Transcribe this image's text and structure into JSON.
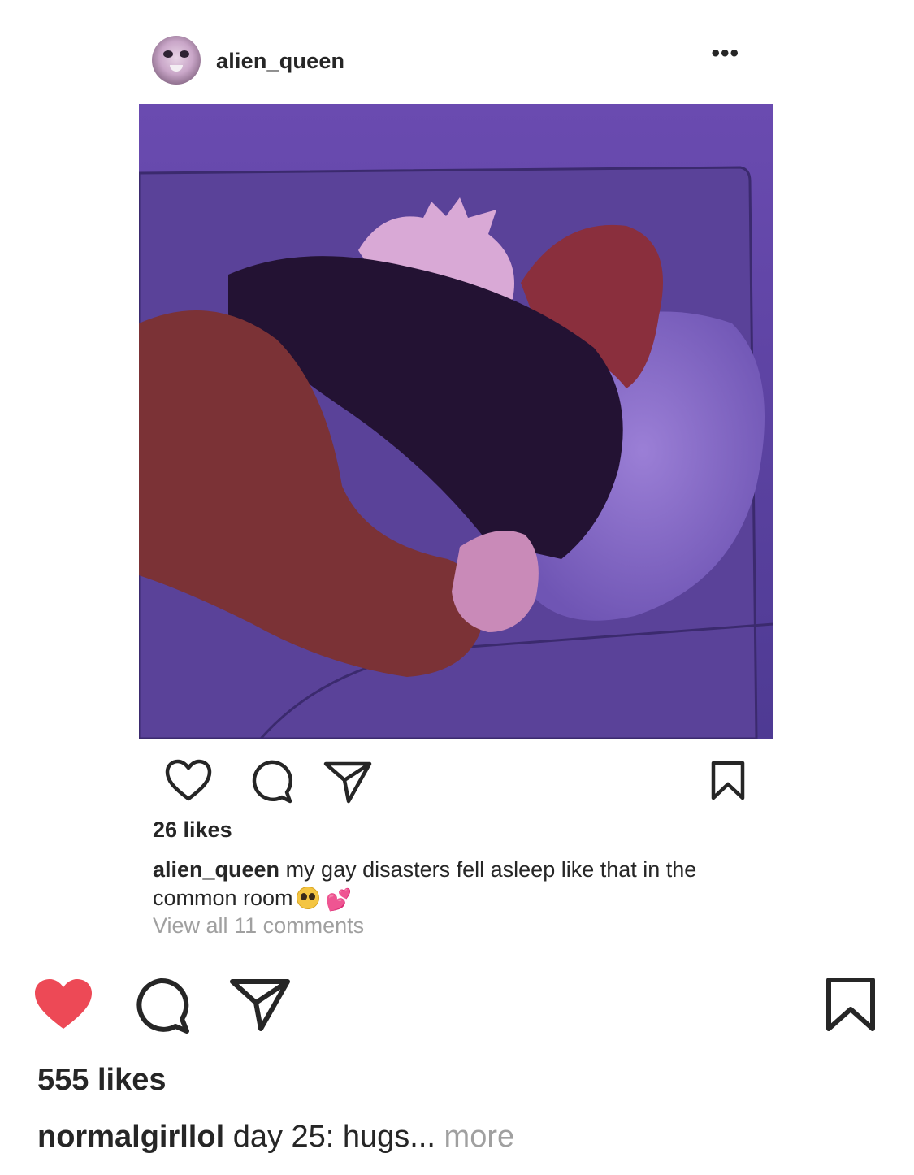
{
  "inner_post": {
    "username": "alien_queen",
    "more_icon": "more-dots-icon",
    "likes": "26 likes",
    "caption_username": "alien_queen",
    "caption_text": " my gay disasters fell asleep like that in the common room",
    "caption_emoji_hearts": "💕",
    "view_all_comments": "View all 11 comments",
    "icons": [
      "heart-outline-icon",
      "comment-icon",
      "share-icon",
      "bookmark-icon"
    ]
  },
  "outer_post": {
    "likes": "555 likes",
    "caption_username": "normalgirllol",
    "caption_text": " day 25: hugs...",
    "more_label": " more",
    "heart_color": "#ed4956",
    "icons": [
      "heart-filled-icon",
      "comment-icon",
      "share-icon",
      "bookmark-icon"
    ]
  }
}
